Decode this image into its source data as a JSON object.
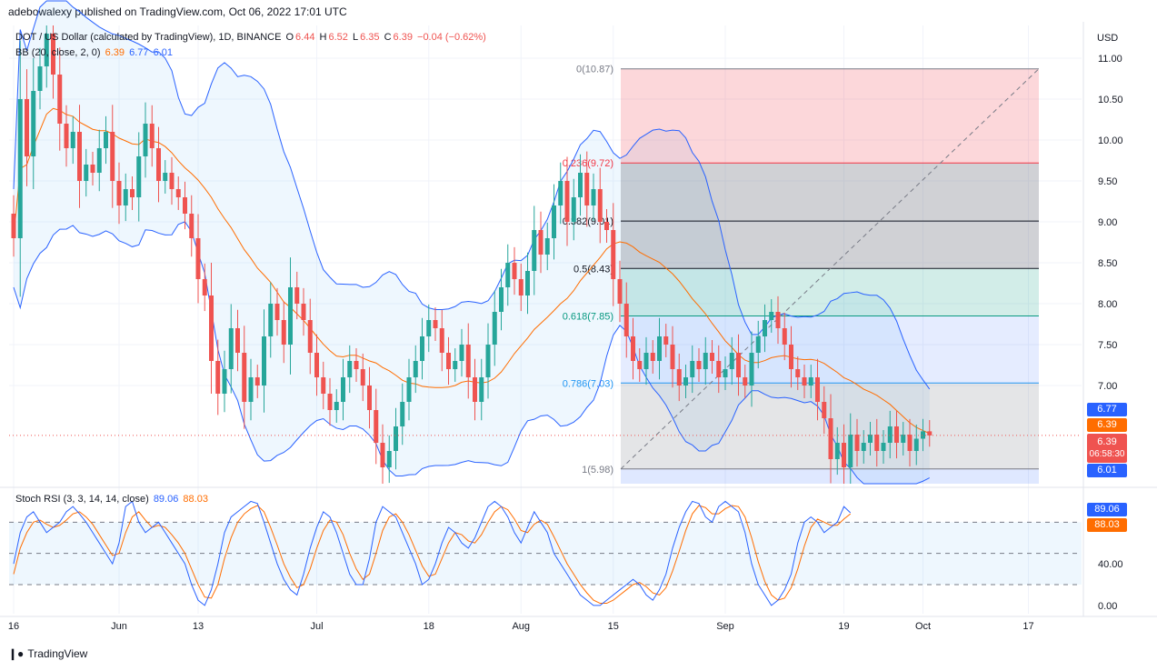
{
  "header": {
    "credit": "adebowalexy published on TradingView.com, Oct 06, 2022 17:01 UTC"
  },
  "legend": {
    "symbol": "DOT / US Dollar (calculated by TradingView), 1D, BINANCE",
    "o_label": "O",
    "o_val": "6.44",
    "h_label": "H",
    "h_val": "6.52",
    "l_label": "L",
    "l_val": "6.35",
    "c_label": "C",
    "c_val": "6.39",
    "change": "−0.04 (−0.62%)",
    "bb_label": "BB (20, close, 2, 0)",
    "bb_basis": "6.39",
    "bb_upper": "6.77",
    "bb_lower": "6.01"
  },
  "rsi_legend": {
    "label": "Stoch RSI (3, 3, 14, 14, close)",
    "k": "89.06",
    "d": "88.03"
  },
  "price_tags": {
    "bb_upper": "6.77",
    "bb_basis": "6.39",
    "last_price": "6.39",
    "countdown": "06:58:30",
    "bb_lower": "6.01",
    "rsi_k": "89.06",
    "rsi_d": "88.03"
  },
  "footer": {
    "brand": "TradingView"
  },
  "colors": {
    "up": "#26a69a",
    "down": "#ef5350",
    "bb_band": "#2962ff",
    "bb_basis": "#ff6d00",
    "rsi_k": "#2962ff",
    "rsi_d": "#ff6d00"
  },
  "chart_data": [
    {
      "type": "candlestick",
      "currency": "USD",
      "ylim": [
        5.8,
        11.4
      ],
      "yticks": [
        11.0,
        10.5,
        10.0,
        9.5,
        9.0,
        8.5,
        8.0,
        7.5,
        7.0
      ],
      "ytick_labels": [
        "11.00",
        "10.50",
        "10.00",
        "9.50",
        "9.00",
        "8.50",
        "8.00",
        "7.50",
        "7.00"
      ],
      "xticks": [
        {
          "label": "16",
          "day": 0
        },
        {
          "label": "Jun",
          "day": 16
        },
        {
          "label": "13",
          "day": 28
        },
        {
          "label": "Jul",
          "day": 46
        },
        {
          "label": "18",
          "day": 63
        },
        {
          "label": "Aug",
          "day": 77
        },
        {
          "label": "15",
          "day": 91
        },
        {
          "label": "Sep",
          "day": 108
        },
        {
          "label": "19",
          "day": 126
        },
        {
          "label": "Oct",
          "day": 138
        },
        {
          "label": "17",
          "day": 154
        }
      ],
      "closes": [
        8.8,
        10.5,
        9.8,
        10.6,
        10.9,
        11.3,
        10.8,
        10.2,
        9.9,
        10.1,
        9.5,
        9.7,
        9.6,
        9.9,
        10.1,
        9.5,
        9.2,
        9.4,
        9.3,
        9.8,
        10.2,
        9.9,
        9.5,
        9.6,
        9.4,
        9.3,
        9.1,
        8.8,
        8.3,
        8.1,
        7.3,
        6.9,
        7.2,
        7.7,
        7.4,
        6.8,
        7.1,
        7.0,
        7.6,
        8.0,
        7.8,
        7.5,
        8.2,
        8.0,
        7.8,
        7.4,
        7.1,
        6.9,
        6.7,
        6.8,
        7.1,
        7.3,
        7.2,
        7.0,
        6.7,
        6.3,
        6.0,
        6.2,
        6.5,
        6.8,
        7.1,
        7.3,
        7.6,
        7.8,
        7.7,
        7.4,
        7.2,
        7.3,
        7.5,
        7.1,
        6.8,
        7.1,
        7.5,
        7.9,
        8.2,
        8.5,
        8.3,
        8.1,
        8.4,
        8.9,
        8.6,
        8.8,
        9.2,
        9.5,
        9.0,
        9.3,
        9.6,
        9.2,
        9.4,
        9.0,
        8.9,
        8.3,
        8.0,
        7.6,
        7.3,
        7.2,
        7.4,
        7.3,
        7.6,
        7.5,
        7.2,
        7.0,
        7.1,
        7.3,
        7.2,
        7.4,
        7.3,
        7.1,
        7.2,
        7.4,
        7.1,
        7.0,
        7.4,
        7.6,
        7.8,
        7.9,
        7.7,
        7.5,
        7.2,
        7.1,
        7.0,
        7.1,
        6.8,
        6.6,
        6.1,
        6.3,
        6.0,
        6.4,
        6.2,
        6.3,
        6.4,
        6.2,
        6.3,
        6.5,
        6.3,
        6.4,
        6.2,
        6.35,
        6.44,
        6.39
      ],
      "bb": {
        "upper_last": 6.77,
        "basis_last": 6.39,
        "lower_last": 6.01
      },
      "last_price": 6.39
    },
    {
      "type": "fibonacci_retracement",
      "levels": [
        {
          "ratio": "0",
          "price": 10.87,
          "label": "0(10.87)"
        },
        {
          "ratio": "0.236",
          "price": 9.72,
          "label": "0.236(9.72)"
        },
        {
          "ratio": "0.382",
          "price": 9.01,
          "label": "0.382(9.01)"
        },
        {
          "ratio": "0.5",
          "price": 8.43,
          "label": "0.5(8.43)"
        },
        {
          "ratio": "0.618",
          "price": 7.85,
          "label": "0.618(7.85)"
        },
        {
          "ratio": "0.786",
          "price": 7.03,
          "label": "0.786(7.03)"
        },
        {
          "ratio": "1",
          "price": 5.98,
          "label": "1(5.98)"
        }
      ]
    },
    {
      "type": "line",
      "title": "Stoch RSI (3, 3, 14, 14, close)",
      "ylim": [
        -8,
        110
      ],
      "yticks": [
        0,
        40,
        80
      ],
      "ytick_labels": [
        "0.00",
        "40.00",
        ""
      ],
      "bands": [
        20,
        50,
        80
      ],
      "series": [
        {
          "name": "K",
          "values": [
            40,
            70,
            85,
            90,
            80,
            70,
            75,
            80,
            90,
            95,
            88,
            80,
            70,
            60,
            50,
            40,
            60,
            95,
            100,
            80,
            70,
            75,
            80,
            70,
            60,
            50,
            40,
            20,
            5,
            0,
            15,
            40,
            70,
            85,
            90,
            95,
            100,
            98,
            80,
            60,
            40,
            25,
            15,
            10,
            30,
            55,
            75,
            90,
            85,
            70,
            50,
            30,
            20,
            20,
            45,
            80,
            95,
            90,
            85,
            70,
            55,
            40,
            20,
            25,
            40,
            60,
            75,
            70,
            60,
            55,
            65,
            80,
            95,
            100,
            95,
            85,
            70,
            60,
            75,
            90,
            80,
            70,
            50,
            40,
            30,
            20,
            10,
            5,
            0,
            0,
            5,
            10,
            15,
            20,
            25,
            20,
            10,
            5,
            15,
            30,
            55,
            75,
            90,
            100,
            98,
            85,
            80,
            95,
            100,
            95,
            90,
            70,
            40,
            20,
            10,
            0,
            5,
            15,
            30,
            60,
            80,
            85,
            80,
            70,
            75,
            80,
            95,
            89
          ]
        },
        {
          "name": "D",
          "values": [
            30,
            55,
            70,
            80,
            82,
            78,
            75,
            77,
            82,
            88,
            90,
            85,
            78,
            68,
            58,
            48,
            50,
            70,
            85,
            90,
            82,
            75,
            77,
            75,
            68,
            60,
            50,
            35,
            20,
            8,
            7,
            20,
            45,
            65,
            80,
            88,
            93,
            96,
            90,
            75,
            58,
            40,
            27,
            17,
            20,
            35,
            55,
            72,
            82,
            80,
            68,
            50,
            35,
            25,
            30,
            50,
            72,
            85,
            88,
            80,
            68,
            53,
            38,
            28,
            30,
            45,
            60,
            70,
            68,
            62,
            60,
            68,
            80,
            90,
            95,
            92,
            83,
            72,
            70,
            78,
            82,
            78,
            66,
            53,
            40,
            30,
            20,
            12,
            5,
            2,
            2,
            5,
            10,
            15,
            20,
            22,
            18,
            12,
            10,
            17,
            33,
            52,
            72,
            88,
            96,
            94,
            88,
            88,
            93,
            96,
            95,
            85,
            65,
            42,
            23,
            10,
            5,
            7,
            17,
            35,
            57,
            75,
            83,
            80,
            77,
            77,
            83,
            88
          ]
        }
      ]
    }
  ]
}
